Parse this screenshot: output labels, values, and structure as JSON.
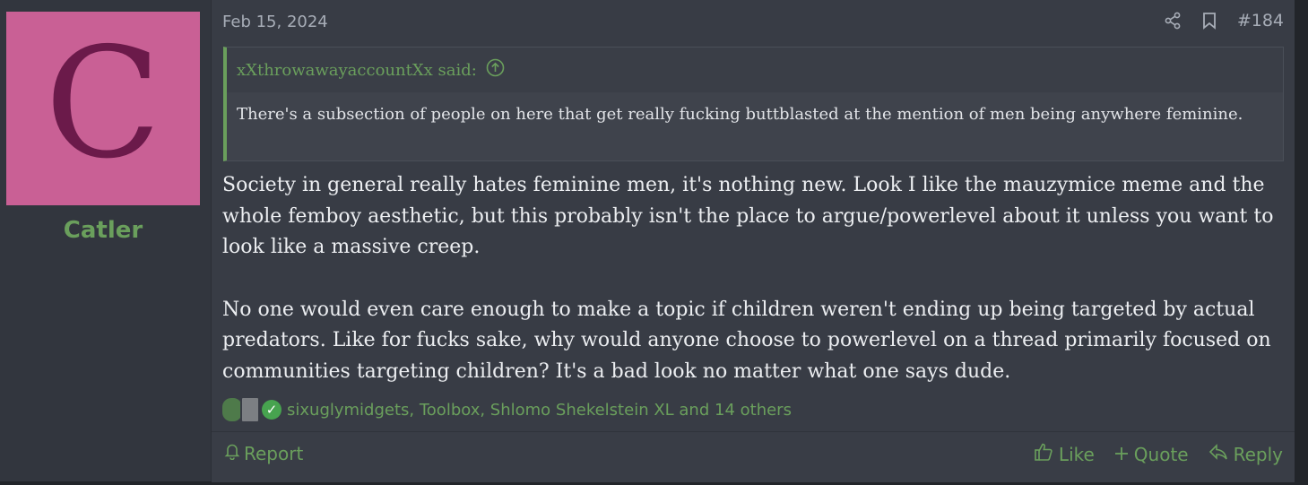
{
  "user": {
    "avatar_letter": "C",
    "avatar_bg": "#c96095",
    "name": "Catler"
  },
  "post": {
    "date": "Feb 15, 2024",
    "number": "#184",
    "quote": {
      "author": "xXthrowawayaccountXx said:",
      "text": "There's a subsection of people on here that get really fucking buttblasted at the mention of men being anywhere feminine."
    },
    "paragraphs": [
      "Society in general really hates feminine men, it's nothing new. Look I like the mauzymice meme and the whole femboy aesthetic, but this probably isn't the place to argue/powerlevel about it unless you want to look like a massive creep.",
      "No one would even care enough to make a topic if children weren't ending up being targeted by actual predators. Like for fucks sake, why would anyone choose to powerlevel on a thread primarily focused on communities targeting children? It's a bad look no matter what one says dude."
    ],
    "reactions_text": "sixuglymidgets, Toolbox, Shlomo Shekelstein XL and 14 others"
  },
  "footer": {
    "report": "Report",
    "like": "Like",
    "quote": "Quote",
    "reply": "Reply"
  },
  "icons": {
    "share": "share-icon",
    "bookmark": "bookmark-icon",
    "quote_up": "arrow-up-circle-icon",
    "bell": "bell-icon",
    "thumb": "thumbs-up-icon",
    "plus": "plus-icon",
    "reply": "reply-icon"
  },
  "colors": {
    "accent": "#6a9f5c",
    "panel": "#383c45",
    "sidebar": "#32363e"
  }
}
